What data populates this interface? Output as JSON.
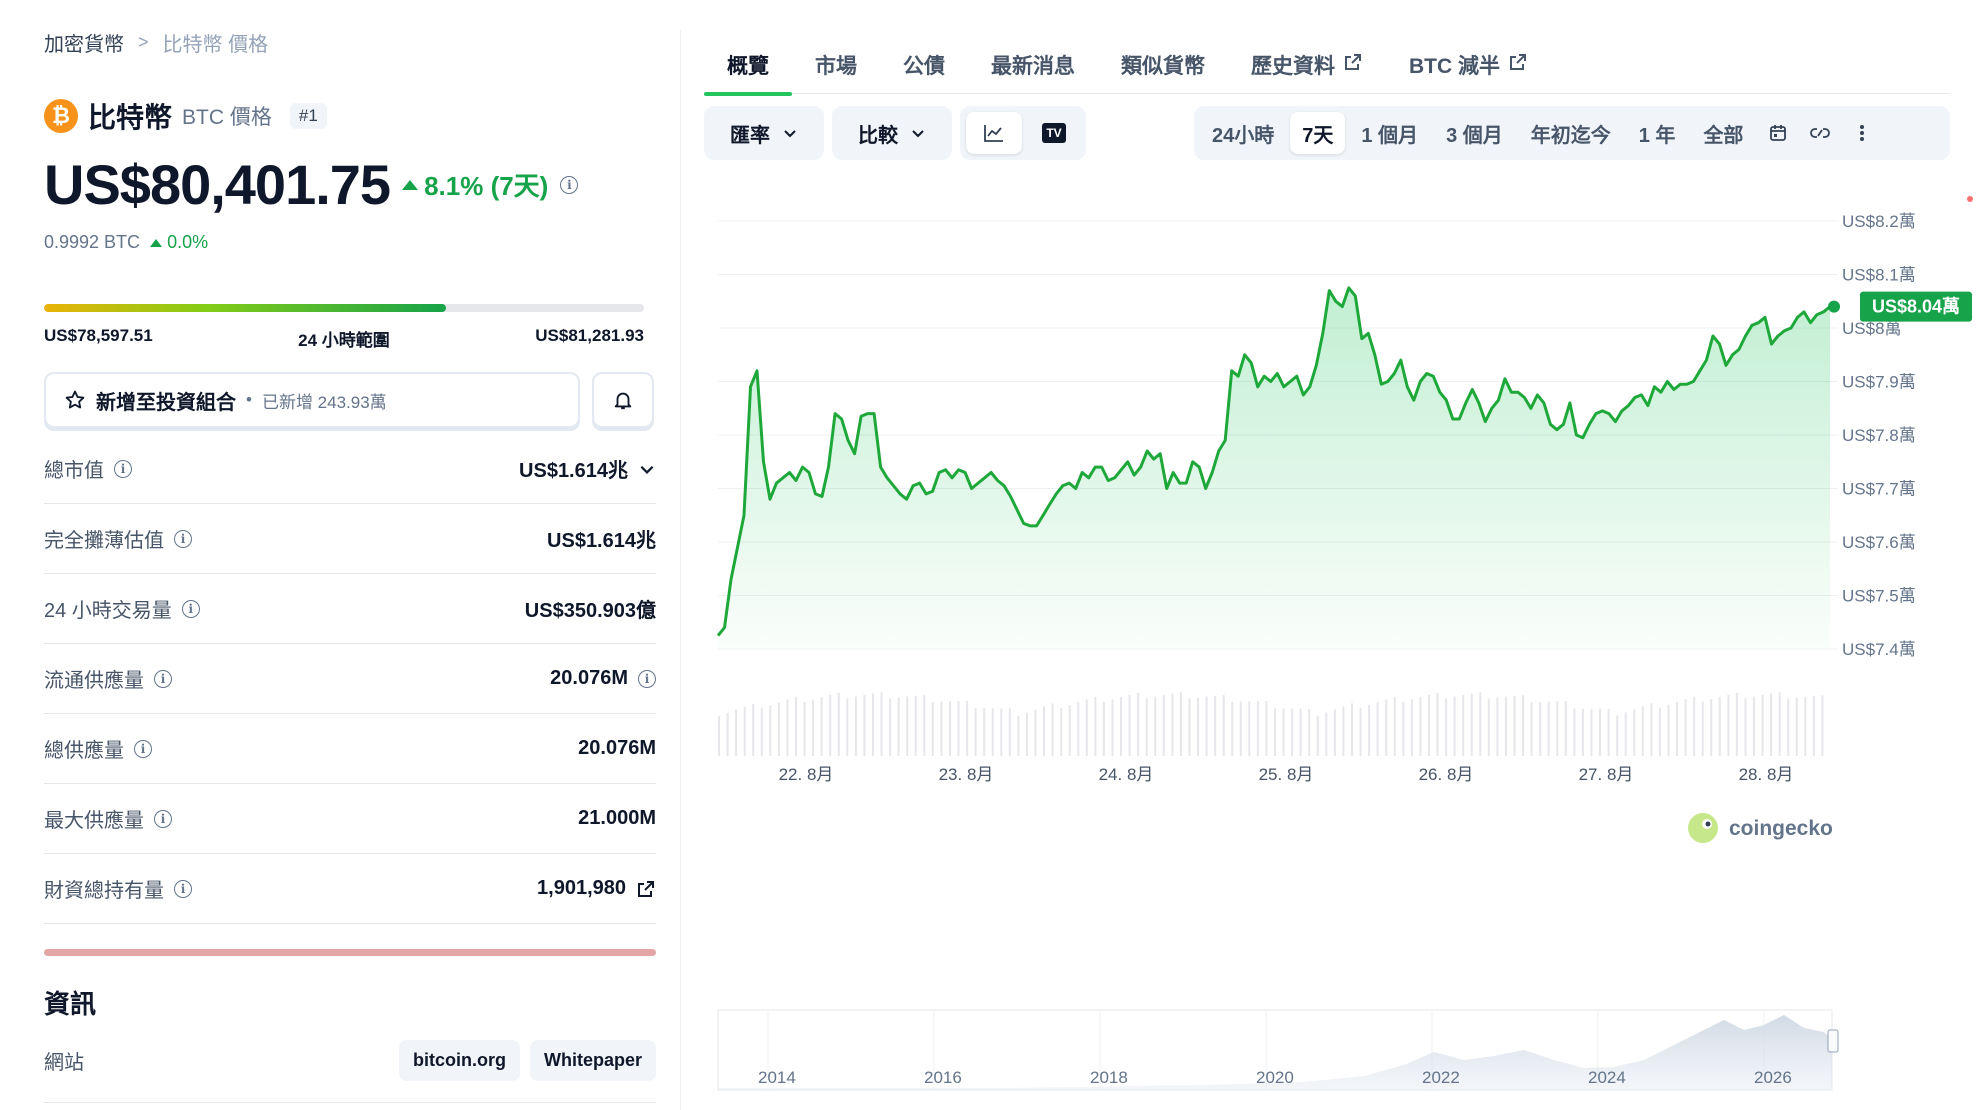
{
  "breadcrumb": {
    "root": "加密貨幣",
    "current": "比特幣 價格"
  },
  "coin": {
    "name": "比特幣",
    "symbol_label": "BTC 價格",
    "rank": "#1",
    "logo_glyph": "₿"
  },
  "price": {
    "value": "US$80,401.75",
    "change": "8.1% (7天)",
    "btc_value": "0.9992 BTC",
    "btc_change": "0.0%"
  },
  "range": {
    "low": "US$78,597.51",
    "label": "24 小時範圍",
    "high": "US$81,281.93",
    "position": 0.67
  },
  "portfolio": {
    "label": "新增至投資組合",
    "dot": "•",
    "added": "已新增 243.93萬"
  },
  "stats": [
    {
      "label": "總市值",
      "value": "US$1.614兆",
      "suffix": "chevron"
    },
    {
      "label": "完全攤薄估值",
      "value": "US$1.614兆",
      "suffix": ""
    },
    {
      "label": "24 小時交易量",
      "value": "US$350.903億",
      "suffix": ""
    },
    {
      "label": "流通供應量",
      "value": "20.076M",
      "suffix": "info"
    },
    {
      "label": "總供應量",
      "value": "20.076M",
      "suffix": ""
    },
    {
      "label": "最大供應量",
      "value": "21.000M",
      "suffix": ""
    },
    {
      "label": "財資總持有量",
      "value": "1,901,980",
      "suffix": "external"
    }
  ],
  "info": {
    "title": "資訊",
    "website_label": "網站",
    "links": [
      "bitcoin.org",
      "Whitepaper"
    ]
  },
  "tabs": [
    {
      "label": "概覽",
      "active": true,
      "external": false
    },
    {
      "label": "市場",
      "active": false,
      "external": false
    },
    {
      "label": "公債",
      "active": false,
      "external": false
    },
    {
      "label": "最新消息",
      "active": false,
      "external": false
    },
    {
      "label": "類似貨幣",
      "active": false,
      "external": false
    },
    {
      "label": "歷史資料",
      "active": false,
      "external": true
    },
    {
      "label": "BTC 減半",
      "active": false,
      "external": true
    }
  ],
  "toolbar": {
    "rate_label": "匯率",
    "compare_label": "比較",
    "tv_label": "TV",
    "ranges": [
      "24小時",
      "7天",
      "1 個月",
      "3 個月",
      "年初迄今",
      "1 年",
      "全部"
    ],
    "active_range": "7天"
  },
  "chart_data": {
    "type": "line",
    "title": "",
    "xlabel": "",
    "ylabel": "",
    "x_ticks": [
      "22. 8月",
      "23. 8月",
      "24. 8月",
      "25. 8月",
      "26. 8月",
      "27. 8月",
      "28. 8月"
    ],
    "y_ticks": [
      "US$8.2萬",
      "US$8.1萬",
      "US$8萬",
      "US$7.9萬",
      "US$7.8萬",
      "US$7.7萬",
      "US$7.6萬",
      "US$7.5萬",
      "US$7.4萬"
    ],
    "y_tick_values": [
      82000,
      81000,
      80000,
      79000,
      78000,
      77000,
      76000,
      75000,
      74000
    ],
    "ylim": [
      74000,
      82000
    ],
    "current_label": "US$8.04萬",
    "series": [
      {
        "values": [
          74250,
          74400,
          75300,
          75900,
          76500,
          78900,
          79200,
          77500,
          76800,
          77100,
          77200,
          77300,
          77150,
          77400,
          77300,
          76900,
          76850,
          77400,
          78400,
          78300,
          77900,
          77650,
          78350,
          78400,
          78400,
          77400,
          77200,
          77050,
          76900,
          76800,
          77050,
          77100,
          76900,
          76950,
          77300,
          77350,
          77200,
          77350,
          77300,
          77000,
          77100,
          77200,
          77300,
          77150,
          77050,
          76850,
          76600,
          76350,
          76300,
          76300,
          76500,
          76700,
          76900,
          77050,
          77100,
          77000,
          77300,
          77200,
          77400,
          77400,
          77150,
          77200,
          77350,
          77500,
          77250,
          77400,
          77700,
          77550,
          77650,
          77000,
          77300,
          77100,
          77100,
          77500,
          77400,
          77000,
          77300,
          77700,
          77900,
          79200,
          79100,
          79500,
          79350,
          78900,
          79100,
          79000,
          79150,
          78900,
          79000,
          79100,
          78750,
          78900,
          79300,
          79900,
          80700,
          80500,
          80400,
          80750,
          80600,
          79800,
          79900,
          79500,
          78950,
          79000,
          79150,
          79400,
          78900,
          78650,
          79000,
          79150,
          79100,
          78800,
          78650,
          78300,
          78300,
          78600,
          78850,
          78600,
          78250,
          78500,
          78650,
          79050,
          78800,
          78800,
          78700,
          78500,
          78750,
          78600,
          78200,
          78100,
          78200,
          78600,
          78000,
          77950,
          78200,
          78400,
          78450,
          78400,
          78250,
          78450,
          78550,
          78700,
          78750,
          78550,
          78900,
          78800,
          79000,
          78850,
          78950,
          78950,
          79000,
          79200,
          79400,
          79850,
          79700,
          79300,
          79500,
          79600,
          79850,
          80050,
          80100,
          80200,
          79700,
          79850,
          79950,
          80000,
          80200,
          80300,
          80100,
          80250,
          80300,
          80400
        ]
      }
    ],
    "navigator_years": [
      "2014",
      "2016",
      "2018",
      "2020",
      "2022",
      "2024",
      "2026"
    ]
  },
  "watermark": {
    "text": "coingecko"
  },
  "colors": {
    "up": "#16a34a",
    "line": "#1fa83a",
    "accent": "#22c55e",
    "btc": "#f7931a",
    "red_bar": "#e3a5a5"
  }
}
